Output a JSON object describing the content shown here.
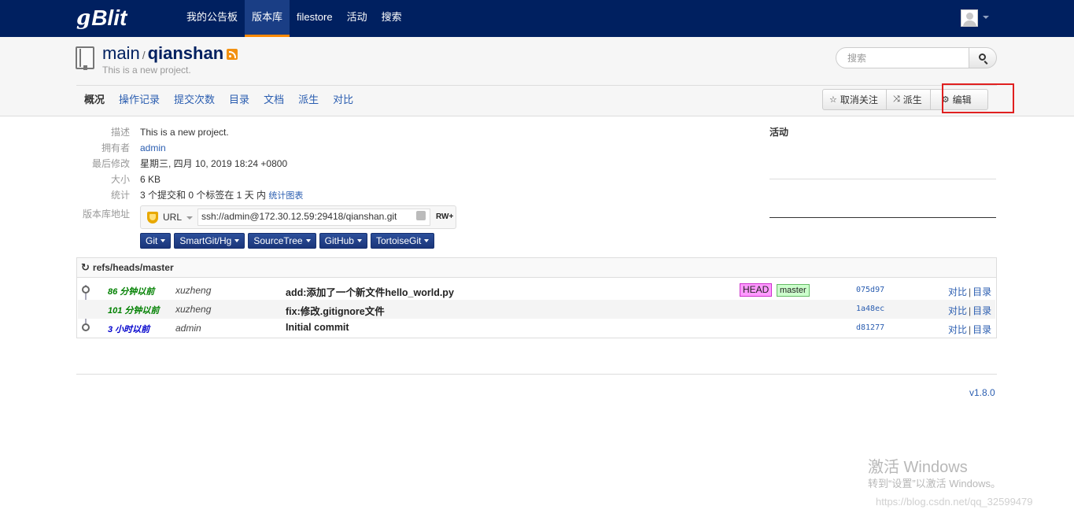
{
  "navbar": {
    "logo_prefix": "g",
    "logo_text": "Blit",
    "items": [
      {
        "label": "我的公告板"
      },
      {
        "label": "版本库"
      },
      {
        "label": "filestore"
      },
      {
        "label": "活动"
      },
      {
        "label": "搜索"
      }
    ],
    "active_item": "版本库"
  },
  "repo": {
    "project": "main",
    "separator": "/",
    "name": "qianshan",
    "description": "This is a new project."
  },
  "search": {
    "placeholder": "搜索",
    "value": ""
  },
  "subnav": {
    "tabs": [
      {
        "label": "概况"
      },
      {
        "label": "操作记录"
      },
      {
        "label": "提交次数"
      },
      {
        "label": "目录"
      },
      {
        "label": "文档"
      },
      {
        "label": "派生"
      },
      {
        "label": "对比"
      }
    ],
    "active": "概况"
  },
  "actions": {
    "unwatch": "取消关注",
    "fork": "派生",
    "edit": "编辑",
    "highlight_color": "#e02020"
  },
  "meta": {
    "description_label": "描述",
    "description_value": "This is a new project.",
    "owner_label": "拥有者",
    "owner_value": "admin",
    "modified_label": "最后修改",
    "modified_value": "星期三, 四月 10, 2019 18:24 +0800",
    "size_label": "大小",
    "size_value": "6 KB",
    "stats_label": "统计",
    "stats_value": "3 个提交和 0 个标签在 1 天 内",
    "stats_link": "统计图表",
    "url_label": "版本库地址"
  },
  "repo_url": {
    "protocol": "URL",
    "value": "ssh://admin@172.30.12.59:29418/qianshan.git",
    "permission": "RW+"
  },
  "clients": [
    {
      "label": "Git"
    },
    {
      "label": "SmartGit/Hg"
    },
    {
      "label": "SourceTree"
    },
    {
      "label": "GitHub"
    },
    {
      "label": "TortoiseGit"
    }
  ],
  "activity": {
    "title": "活动"
  },
  "commits": {
    "branch": "refs/heads/master",
    "rows": [
      {
        "age": "86 分钟以前",
        "author": "xuzheng",
        "message": "add:添加了一个新文件hello_world.py",
        "refs": [
          "HEAD",
          "master"
        ],
        "sha": "075d97",
        "compare": "对比",
        "tree": "目录"
      },
      {
        "age": "101 分钟以前",
        "author": "xuzheng",
        "message": "fix:修改.gitignore文件",
        "refs": [],
        "sha": "1a48ec",
        "compare": "对比",
        "tree": "目录"
      },
      {
        "age": "3 小时以前",
        "author": "admin",
        "message": "Initial commit",
        "refs": [],
        "sha": "d81277",
        "compare": "对比",
        "tree": "目录"
      }
    ]
  },
  "footer": {
    "version": "v1.8.0"
  },
  "watermark": {
    "line1": "激活 Windows",
    "line2": "转到“设置”以激活 Windows。",
    "line3": "https://blog.csdn.net/qq_32599479"
  },
  "colors": {
    "navbar": "#002060",
    "link": "#2a5db0",
    "head_ref": "#ff99ff",
    "master_ref": "#ccffcc"
  }
}
